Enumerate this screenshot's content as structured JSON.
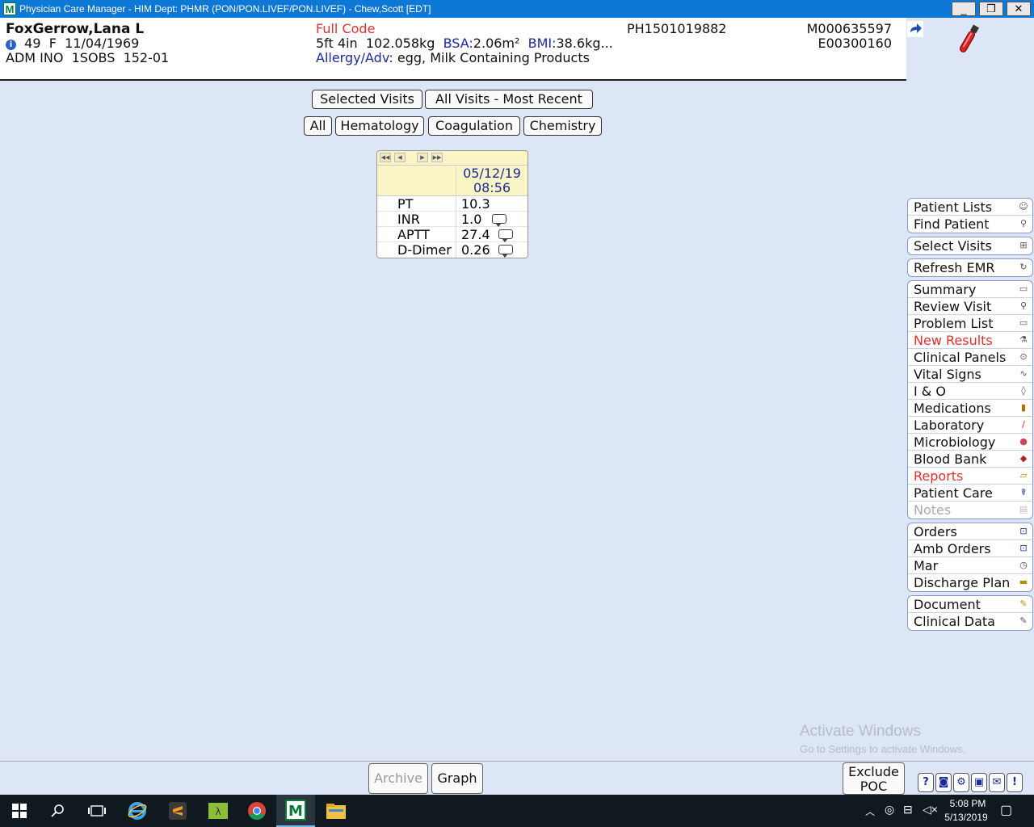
{
  "window": {
    "title": "Physician Care Manager - HIM Dept: PHMR (PON/PON.LIVEF/PON.LIVEF) - Chew,Scott [EDT]",
    "logo_letter": "M",
    "min": "_",
    "restore": "❐",
    "close": "✕"
  },
  "patient": {
    "name": "FoxGerrow,Lana L",
    "info_glyph": "i",
    "age": "49",
    "sex": "F",
    "dob": "11/04/1969",
    "status": "ADM INO",
    "location": "1SOBS",
    "room": "152-01",
    "code_status": "Full Code",
    "height": "5ft 4in",
    "weight": "102.058kg",
    "bsa_label": "BSA:",
    "bsa": "2.06m²",
    "bmi_label": "BMI:",
    "bmi": "38.6kg...",
    "allergy_label": "Allergy/Adv:",
    "allergies": "egg, Milk Containing Products",
    "account": "PH1501019882",
    "mrn": "M000635597",
    "enc": "E00300160"
  },
  "visit_buttons": {
    "selected": "Selected Visits",
    "all_recent": "All Visits - Most Recent"
  },
  "filter_buttons": {
    "all": "All",
    "hematology": "Hematology",
    "coagulation": "Coagulation",
    "chemistry": "Chemistry"
  },
  "lab": {
    "nav": {
      "first": "◀◀",
      "prev": "◀",
      "next": "▶",
      "last": "▶▶"
    },
    "date": "05/12/19",
    "time": "08:56",
    "rows": [
      {
        "test": "PT",
        "value": "10.3"
      },
      {
        "test": "INR",
        "value": "1.0"
      },
      {
        "test": "APTT",
        "value": "27.4"
      },
      {
        "test": "D-Dimer",
        "value": "0.26"
      }
    ]
  },
  "sidebar": {
    "patient_lists": "Patient Lists",
    "find_patient": "Find Patient",
    "select_visits": "Select Visits",
    "refresh_emr": "Refresh EMR",
    "summary": "Summary",
    "review_visit": "Review Visit",
    "problem_list": "Problem List",
    "new_results": "New Results",
    "clinical_panels": "Clinical Panels",
    "vital_signs": "Vital Signs",
    "i_o": "I & O",
    "medications": "Medications",
    "laboratory": "Laboratory",
    "microbiology": "Microbiology",
    "blood_bank": "Blood Bank",
    "reports": "Reports",
    "patient_care": "Patient Care",
    "notes": "Notes",
    "orders": "Orders",
    "amb_orders": "Amb Orders",
    "mar": "Mar",
    "discharge_plan": "Discharge Plan",
    "document": "Document",
    "clinical_data": "Clinical Data"
  },
  "bottom": {
    "archive": "Archive",
    "graph": "Graph",
    "exclude_line1": "Exclude",
    "exclude_line2": "POC",
    "help": "?",
    "alert": "!"
  },
  "watermark": {
    "line1": "Activate Windows",
    "line2": "Go to Settings to activate Windows."
  },
  "taskbar": {
    "time": "5:08 PM",
    "date": "5/13/2019"
  },
  "colors": {
    "accent": "#0e78d6",
    "alert_red": "#e03030",
    "navy": "#1a2a9a",
    "background": "#dde6f7"
  }
}
